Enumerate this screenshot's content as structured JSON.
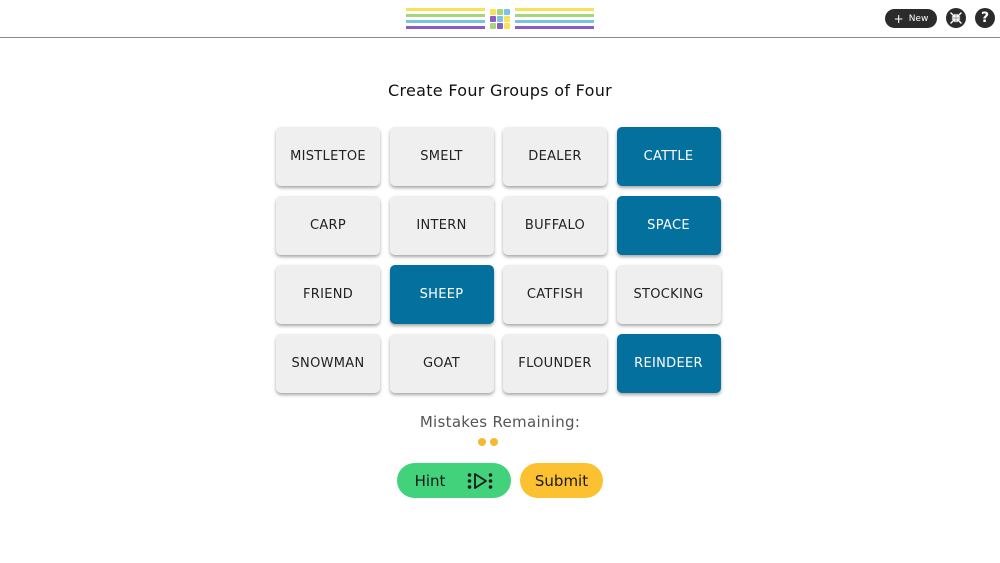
{
  "header": {
    "new_label": "New",
    "new_icon": "plus-icon",
    "shrink_icon": "shrink-icon",
    "help_label": "?"
  },
  "game": {
    "title": "Create Four Groups of Four",
    "tiles": [
      {
        "word": "MISTLETOE",
        "selected": false
      },
      {
        "word": "SMELT",
        "selected": false
      },
      {
        "word": "DEALER",
        "selected": false
      },
      {
        "word": "CATTLE",
        "selected": true
      },
      {
        "word": "CARP",
        "selected": false
      },
      {
        "word": "INTERN",
        "selected": false
      },
      {
        "word": "BUFFALO",
        "selected": false
      },
      {
        "word": "SPACE",
        "selected": true
      },
      {
        "word": "FRIEND",
        "selected": false
      },
      {
        "word": "SHEEP",
        "selected": true
      },
      {
        "word": "CATFISH",
        "selected": false
      },
      {
        "word": "STOCKING",
        "selected": false
      },
      {
        "word": "SNOWMAN",
        "selected": false
      },
      {
        "word": "GOAT",
        "selected": false
      },
      {
        "word": "FLOUNDER",
        "selected": false
      },
      {
        "word": "REINDEER",
        "selected": true
      }
    ],
    "mistakes_label": "Mistakes Remaining:",
    "mistakes_remaining": 2,
    "hint_label": "Hint",
    "hint_icon": "video-play-icon",
    "submit_label": "Submit"
  },
  "colors": {
    "selected_tile": "#04709e",
    "tile": "#efefef",
    "hint": "#43d27c",
    "submit": "#fcc131",
    "mistake_dot": "#f5b833"
  }
}
